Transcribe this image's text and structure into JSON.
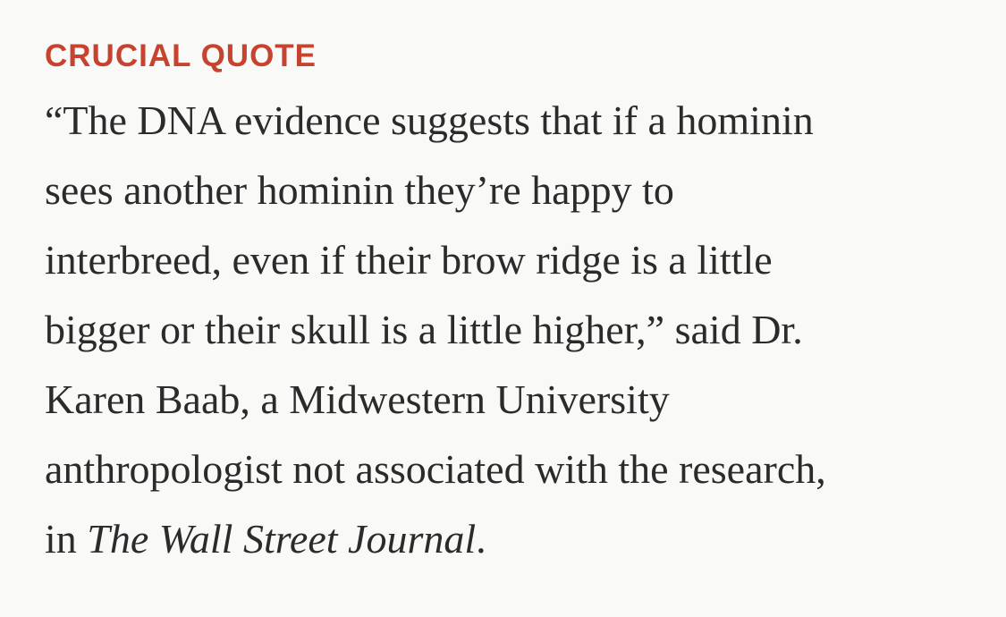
{
  "section_label": "CRUCIAL QUOTE",
  "quote": {
    "lines": [
      "“The DNA evidence suggests that if a hominin",
      "sees another hominin they’re happy to",
      "interbreed, even if their brow ridge is a little",
      "bigger or their skull is a little higher,” said Dr.",
      "Karen Baab, a Midwestern University",
      "anthropologist not associated with the research,"
    ],
    "last_line_prefix": "in ",
    "publication": "The Wall Street Journal",
    "last_line_suffix": "."
  },
  "colors": {
    "label": "#c6432f",
    "text": "#2b2b2b",
    "background": "#f9f9f8"
  }
}
